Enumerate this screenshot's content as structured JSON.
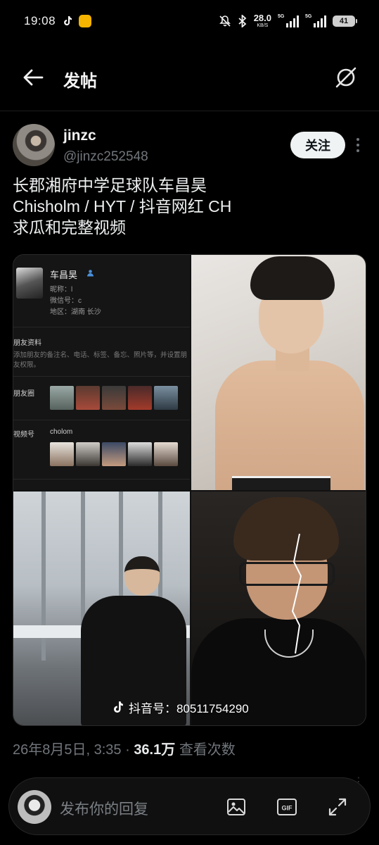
{
  "status_bar": {
    "time": "19:08",
    "net_speed": "28.0",
    "net_unit": "KB/S",
    "sim1_type": "5G",
    "sim2_type": "5G",
    "battery": "41"
  },
  "nav": {
    "title": "发帖",
    "back_icon": "arrow-left-icon",
    "grok_icon": "grok-icon"
  },
  "post": {
    "author_name": "jinzc",
    "author_handle": "@jinzc252548",
    "follow_label": "关注",
    "text_lines": [
      "长郡湘府中学足球队车昌昊",
      "Chisholm / HYT / 抖音网红 CH",
      "求瓜和完整视频"
    ],
    "media": {
      "profile_card": {
        "name": "车昌昊",
        "nickname_label": "昵称：l",
        "wechat_label": "微信号：c",
        "region_label": "地区：湖南 长沙",
        "section_friend_info": "朋友资料",
        "friend_info_desc": "添加朋友的备注名、电话、标签、备忘、照片等，并设置朋友权限。",
        "section_moments": "朋友圈",
        "section_channels": "视频号",
        "channel_name": "cholom"
      },
      "douyin_watermark": "抖音号：80511754290"
    },
    "timestamp": "26年8月5日, 3:35",
    "view_count": "36.1万",
    "view_label": "查看次数"
  },
  "reply_bar": {
    "placeholder": "发布你的回复",
    "icons": [
      "image-icon",
      "gif-icon",
      "expand-icon"
    ],
    "gif_label": "GIF"
  }
}
